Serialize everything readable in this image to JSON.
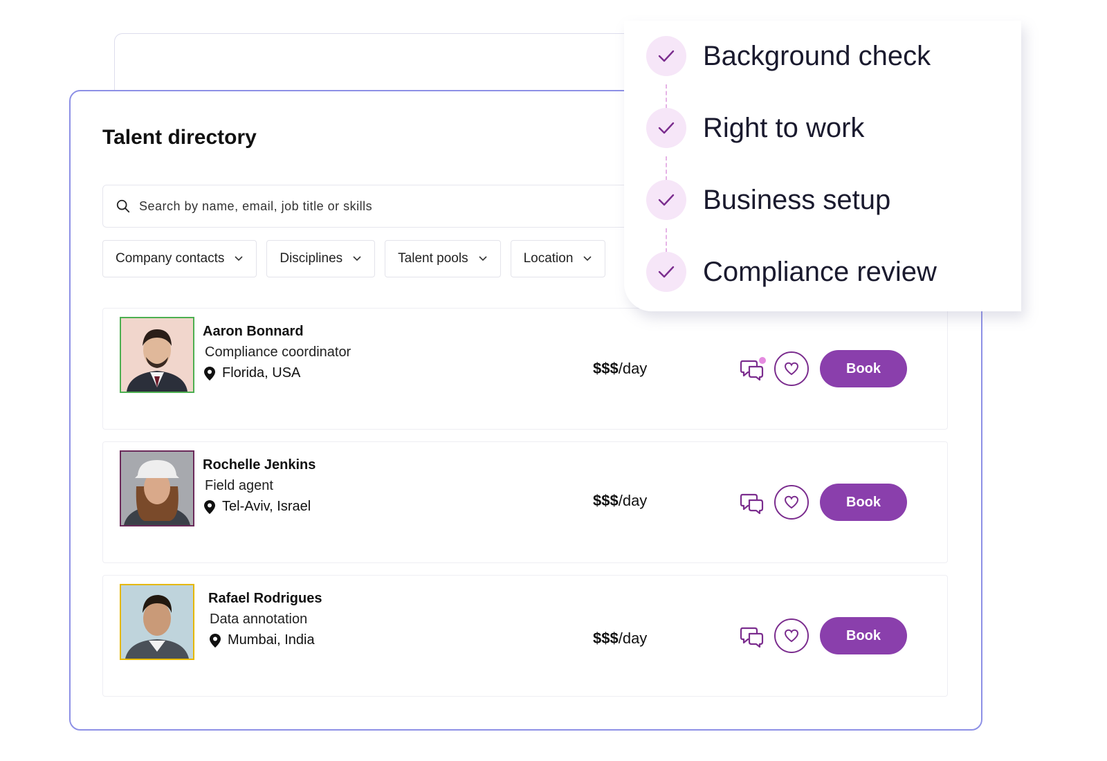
{
  "directory": {
    "title": "Talent directory",
    "search_placeholder": "Search by name, email, job title or skills",
    "filters": [
      {
        "label": "Company contacts"
      },
      {
        "label": "Disciplines"
      },
      {
        "label": "Talent pools"
      },
      {
        "label": "Location"
      }
    ],
    "rows": [
      {
        "name": "Aaron Bonnard",
        "role": "Compliance coordinator",
        "location": "Florida, USA",
        "price_symbol": "$$$",
        "price_unit": "/day",
        "book_label": "Book",
        "avatar_border": "#4caf50",
        "has_unread": true
      },
      {
        "name": "Rochelle Jenkins",
        "role": "Field agent",
        "location": "Tel-Aviv, Israel",
        "price_symbol": "$$$",
        "price_unit": "/day",
        "book_label": "Book",
        "avatar_border": "#6b2a5a",
        "has_unread": false
      },
      {
        "name": "Rafael Rodrigues",
        "role": "Data annotation",
        "location": "Mumbai, India",
        "price_symbol": "$$$",
        "price_unit": "/day",
        "book_label": "Book",
        "avatar_border": "#e6b800",
        "has_unread": false
      }
    ]
  },
  "checklist": {
    "items": [
      {
        "label": "Background check"
      },
      {
        "label": "Right to work"
      },
      {
        "label": "Business setup"
      },
      {
        "label": "Compliance review"
      }
    ]
  },
  "colors": {
    "accent": "#8a3fac",
    "card_border": "#8d90e6",
    "check_bg": "#f6e6f8",
    "check_mark": "#7b2d8e"
  },
  "icons": {
    "search": "search-icon",
    "chevron": "chevron-down-icon",
    "pin": "map-pin-icon",
    "chat": "chat-bubbles-icon",
    "heart": "heart-icon",
    "check": "check-icon"
  }
}
